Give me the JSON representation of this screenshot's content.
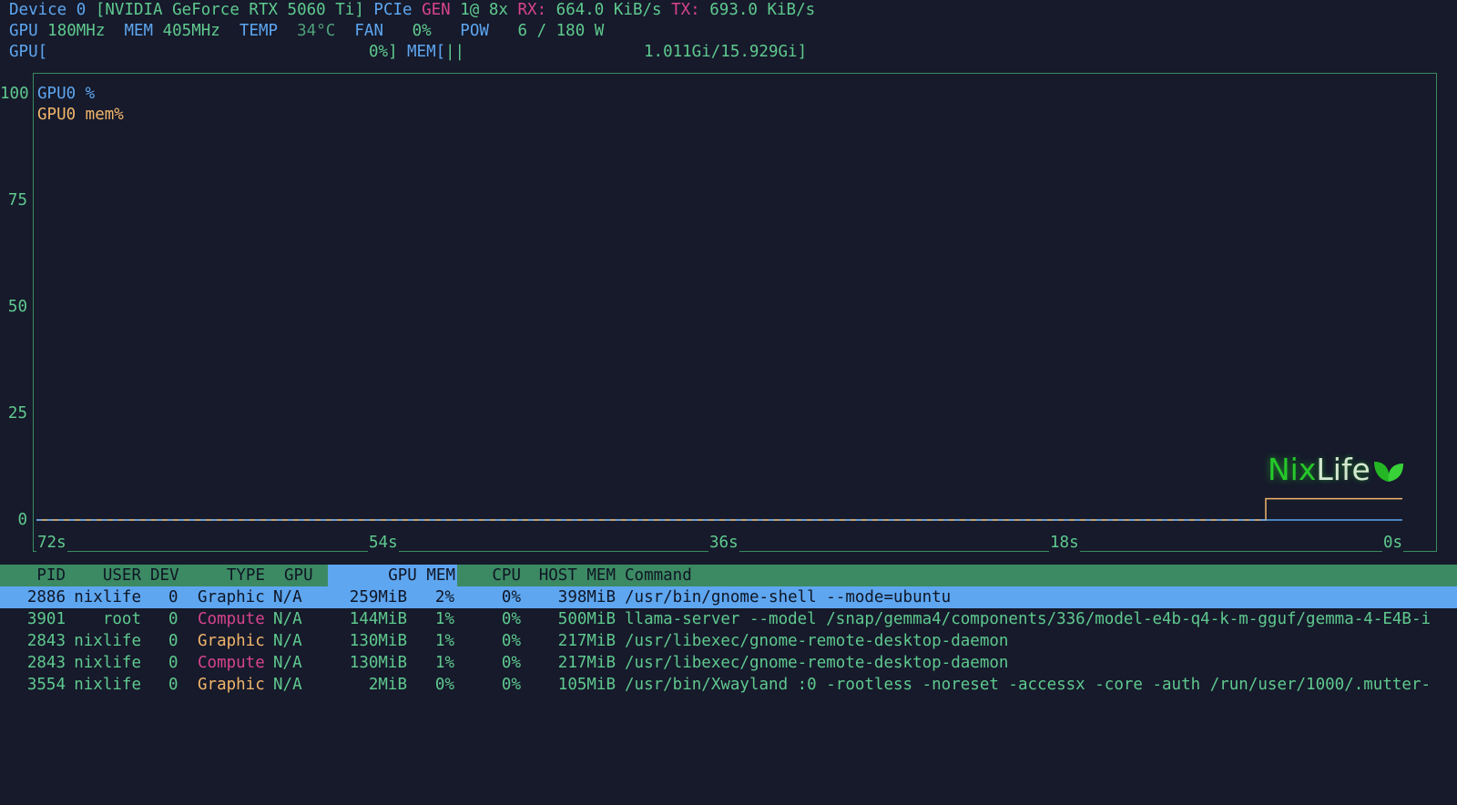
{
  "header": {
    "device": "Device 0",
    "device_name": "[NVIDIA GeForce RTX 5060 Ti]",
    "pcie_label": "PCIe",
    "gen_label": "GEN",
    "gen_value": "1@ 8x",
    "rx_label": "RX:",
    "rx_value": "664.0 KiB/s",
    "tx_label": "TX:",
    "tx_value": "693.0 KiB/s",
    "gpu_clock_label": "GPU",
    "gpu_clock_value": "180MHz",
    "mem_clock_label": "MEM",
    "mem_clock_value": "405MHz",
    "temp_label": "TEMP",
    "temp_value": "34°C",
    "fan_label": "FAN",
    "fan_value": "0%",
    "pow_label": "POW",
    "pow_value": "6 / 180 W",
    "gpu_bar_label": "GPU[",
    "gpu_bar_value": "0%]",
    "gpu_util_percent": 0,
    "mem_bar_label": "MEM[",
    "mem_bar_fill": "||",
    "mem_bar_value": "1.011Gi/15.929Gi]"
  },
  "chart_data": {
    "type": "line",
    "y_ticks": [
      "100",
      "75",
      "50",
      "25",
      "0"
    ],
    "x_ticks": [
      "72s",
      "54s",
      "36s",
      "18s",
      "0s"
    ],
    "ylim": [
      0,
      100
    ],
    "series": [
      {
        "name": "GPU0 %",
        "color": "#5ea6f0",
        "values": [
          0,
          0
        ]
      },
      {
        "name": "GPU0 mem%",
        "color": "#f2b56b",
        "values": [
          0,
          5
        ]
      }
    ]
  },
  "watermark": {
    "text_nix": "Nix",
    "text_life": "Life"
  },
  "table": {
    "headers": {
      "pid": "PID",
      "user": "USER",
      "dev": "DEV",
      "type": "TYPE",
      "gpu": "GPU",
      "gpu_mem": "GPU MEM",
      "cpu": "CPU",
      "host_mem": "HOST MEM",
      "command": "Command"
    },
    "rows": [
      {
        "pid": "2886",
        "user": "nixlife",
        "dev": "0",
        "type": "Graphic",
        "gpu": "N/A",
        "gpu_mem": "259MiB",
        "gpu_mem_pct": "2%",
        "cpu": "0%",
        "host_mem": "398MiB",
        "command": "/usr/bin/gnome-shell --mode=ubuntu"
      },
      {
        "pid": "3901",
        "user": "root",
        "dev": "0",
        "type": "Compute",
        "gpu": "N/A",
        "gpu_mem": "144MiB",
        "gpu_mem_pct": "1%",
        "cpu": "0%",
        "host_mem": "500MiB",
        "command": "llama-server --model /snap/gemma4/components/336/model-e4b-q4-k-m-gguf/gemma-4-E4B-i"
      },
      {
        "pid": "2843",
        "user": "nixlife",
        "dev": "0",
        "type": "Graphic",
        "gpu": "N/A",
        "gpu_mem": "130MiB",
        "gpu_mem_pct": "1%",
        "cpu": "0%",
        "host_mem": "217MiB",
        "command": "/usr/libexec/gnome-remote-desktop-daemon"
      },
      {
        "pid": "2843",
        "user": "nixlife",
        "dev": "0",
        "type": "Compute",
        "gpu": "N/A",
        "gpu_mem": "130MiB",
        "gpu_mem_pct": "1%",
        "cpu": "0%",
        "host_mem": "217MiB",
        "command": "/usr/libexec/gnome-remote-desktop-daemon"
      },
      {
        "pid": "3554",
        "user": "nixlife",
        "dev": "0",
        "type": "Graphic",
        "gpu": "N/A",
        "gpu_mem": "2MiB",
        "gpu_mem_pct": "0%",
        "cpu": "0%",
        "host_mem": "105MiB",
        "command": "/usr/bin/Xwayland :0 -rootless -noreset -accessx -core -auth /run/user/1000/.mutter-"
      }
    ]
  }
}
